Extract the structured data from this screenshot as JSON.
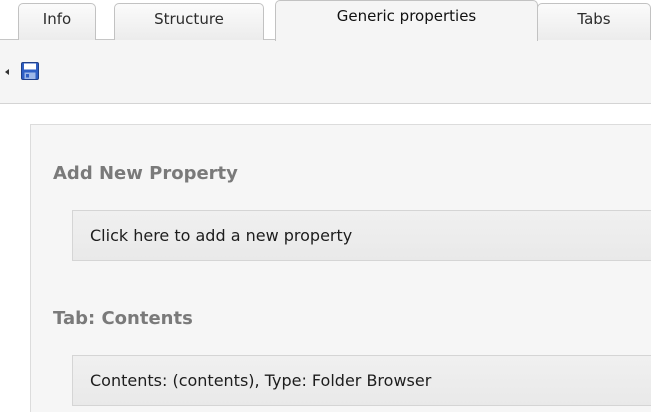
{
  "tabs": [
    {
      "label": "Info",
      "active": false
    },
    {
      "label": "Structure",
      "active": false
    },
    {
      "label": "Generic properties",
      "active": true
    },
    {
      "label": "Tabs",
      "active": false
    }
  ],
  "toolbar": {
    "save_icon": "floppy-disk-icon",
    "collapse_icon": "arrow-left-icon"
  },
  "add_property": {
    "title": "Add New Property",
    "button_label": "Click here to add a new property"
  },
  "tab_section": {
    "title": "Tab: Contents",
    "properties": [
      {
        "label": "Contents: (contents), Type: Folder Browser"
      }
    ]
  },
  "colors": {
    "section_title": "#7a7a7a",
    "panel_bg": "#f6f6f6",
    "toolbar_bg": "#f5f5f5",
    "save_icon_blue": "#2f5fc4"
  }
}
